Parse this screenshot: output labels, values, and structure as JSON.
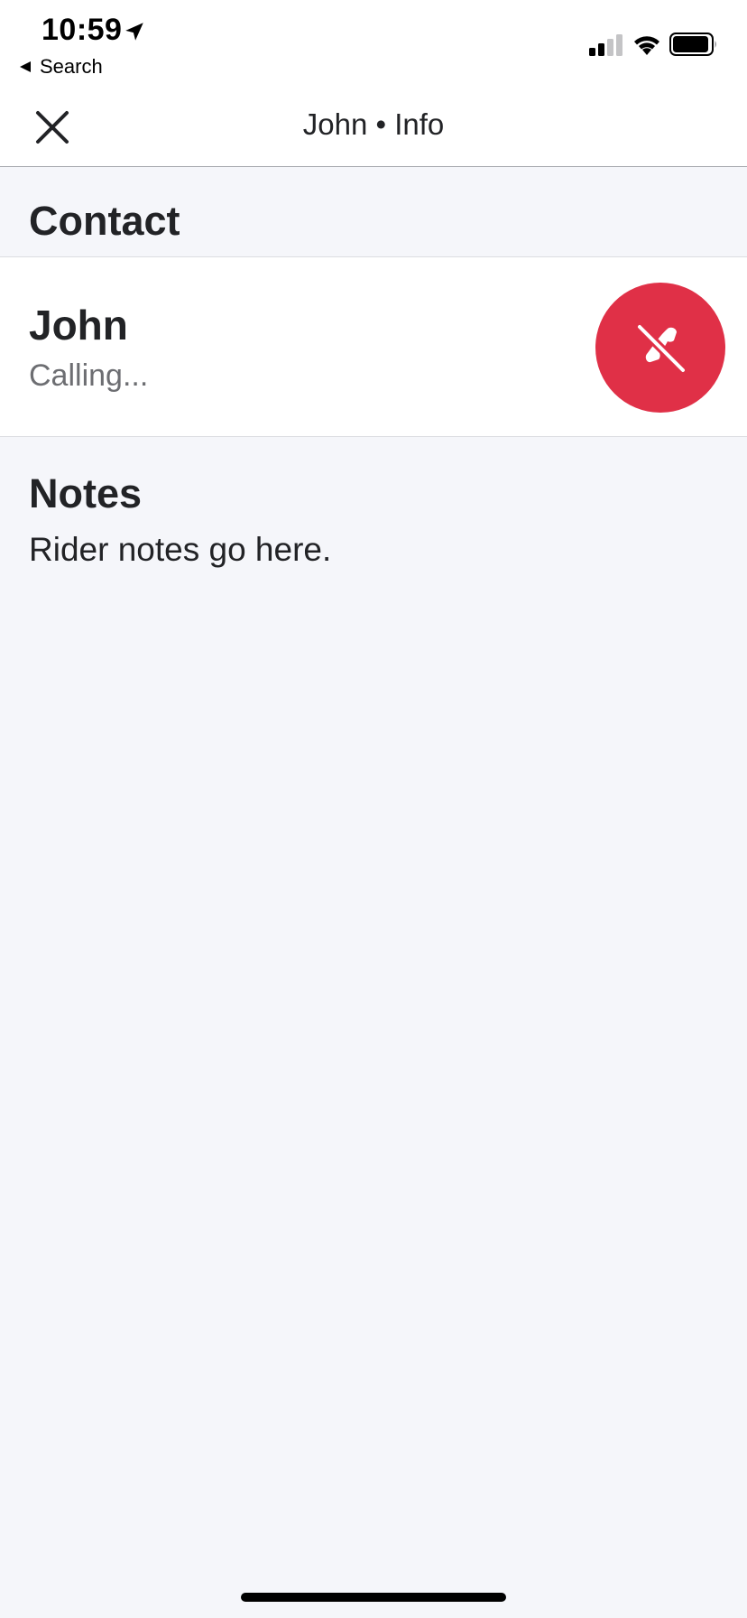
{
  "status_bar": {
    "time": "10:59",
    "back_app_label": "Search",
    "icons": [
      "location-arrow-icon",
      "back-arrow-icon",
      "signal-icon",
      "wifi-icon",
      "battery-icon"
    ]
  },
  "nav": {
    "title": "John • Info",
    "close_icon": "close-icon"
  },
  "contact_section": {
    "title": "Contact"
  },
  "contact": {
    "name": "John",
    "status": "Calling...",
    "end_call_icon": "phone-hangup-icon",
    "end_call_color": "#e03047"
  },
  "notes": {
    "title": "Notes",
    "body": "Rider notes go here."
  },
  "colors": {
    "background": "#f5f6fa",
    "surface": "#ffffff",
    "text_primary": "#222326",
    "text_secondary": "#6d6e72",
    "accent_red": "#e03047"
  }
}
